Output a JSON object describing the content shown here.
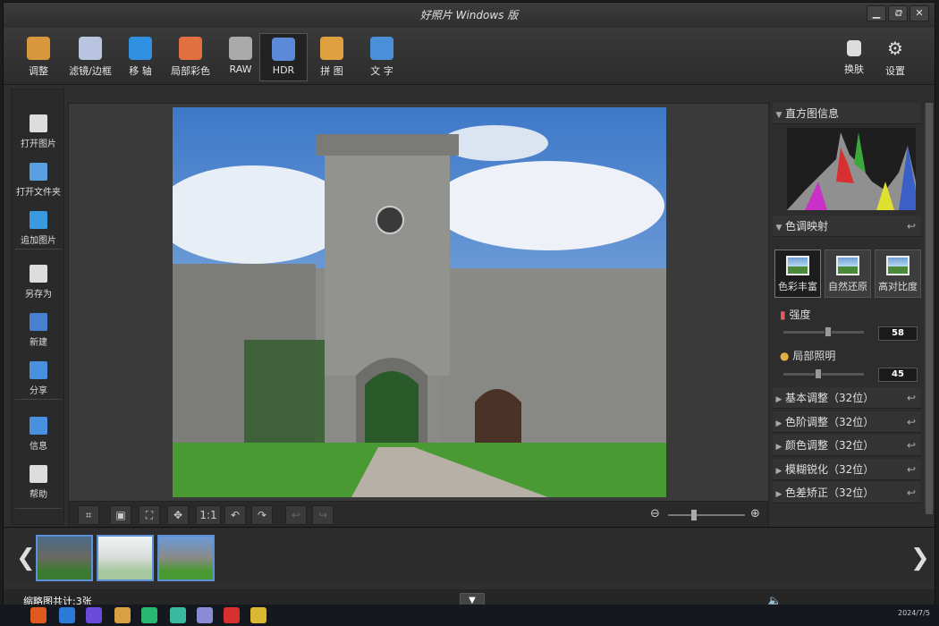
{
  "window": {
    "title": "好照片 Windows 版",
    "buttons": [
      "▁",
      "⧉",
      "✕"
    ]
  },
  "toolbar": {
    "items": [
      {
        "label": "调整",
        "icon": "pencil-icon",
        "color": "#d8973c"
      },
      {
        "label": "滤镜/边框",
        "icon": "brush-icon",
        "color": "#b8c4e0"
      },
      {
        "label": "移 轴",
        "icon": "drop-icon",
        "color": "#2f8fe0"
      },
      {
        "label": "局部彩色",
        "icon": "palette-icon",
        "color": "#e07040"
      },
      {
        "label": "RAW",
        "icon": "camera-icon",
        "color": "#aaaaaa"
      },
      {
        "label": "HDR",
        "icon": "hdr-icon",
        "color": "#5a8ad8"
      },
      {
        "label": "拼 图",
        "icon": "collage-icon",
        "color": "#e0a040"
      },
      {
        "label": "文 字",
        "icon": "text-icon",
        "color": "#4a90d8"
      }
    ],
    "skin": "换肤",
    "settings": "设置"
  },
  "leftbar": {
    "items": [
      {
        "label": "打开图片",
        "icon": "open-image-icon"
      },
      {
        "label": "打开文件夹",
        "icon": "open-folder-icon"
      },
      {
        "label": "追加图片",
        "icon": "add-image-icon"
      },
      {
        "label": "另存为",
        "icon": "save-as-icon"
      },
      {
        "label": "新建",
        "icon": "new-hdr-icon"
      },
      {
        "label": "分享",
        "icon": "share-icon"
      },
      {
        "label": "信息",
        "icon": "info-icon"
      },
      {
        "label": "帮助",
        "icon": "help-icon"
      }
    ]
  },
  "controls": {
    "one_to_one": "1:1"
  },
  "panel": {
    "histogram": "直方图信息",
    "tone_mapping": "色调映射",
    "presets": [
      {
        "label": "色彩丰富",
        "selected": true
      },
      {
        "label": "自然还原",
        "selected": false
      },
      {
        "label": "高对比度",
        "selected": false
      }
    ],
    "strength": {
      "label": "强度",
      "value": "58",
      "level": 0.58
    },
    "local_light": {
      "label": "局部照明",
      "value": "45",
      "level": 0.45
    },
    "sections": [
      "基本调整（32位）",
      "色阶调整（32位）",
      "颜色调整（32位）",
      "模糊锐化（32位）",
      "色差矫正（32位）"
    ]
  },
  "status": {
    "thumb_count": "缩略图共计:3张",
    "date": "2024/7/5"
  }
}
